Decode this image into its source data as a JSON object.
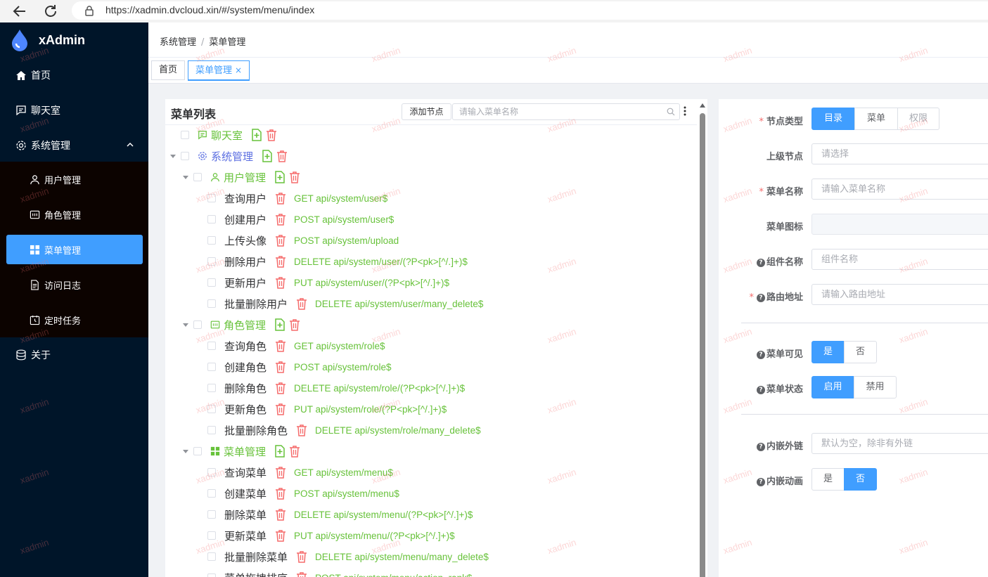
{
  "browser": {
    "url": "https://xadmin.dvcloud.xin/#/system/menu/index"
  },
  "app": {
    "name": "xAdmin"
  },
  "sidebar": {
    "items": [
      {
        "label": "首页",
        "icon": "home-icon"
      },
      {
        "label": "聊天室",
        "icon": "chat-icon"
      },
      {
        "label": "系统管理",
        "icon": "gear-icon"
      },
      {
        "label": "关于",
        "icon": "database-icon"
      }
    ],
    "submenu": [
      {
        "label": "用户管理",
        "icon": "user-icon"
      },
      {
        "label": "角色管理",
        "icon": "role-icon"
      },
      {
        "label": "菜单管理",
        "icon": "grid-icon",
        "active": true
      },
      {
        "label": "访问日志",
        "icon": "document-icon"
      },
      {
        "label": "定时任务",
        "icon": "clock-icon"
      }
    ]
  },
  "breadcrumb": {
    "first": "系统管理",
    "separator": "/",
    "second": "菜单管理"
  },
  "tabs": [
    {
      "label": "首页"
    },
    {
      "label": "菜单管理",
      "close": "×",
      "active": true
    }
  ],
  "tree_panel": {
    "title": "菜单列表",
    "add_node": "添加节点",
    "search_placeholder": "请输入菜单名称",
    "rows": [
      {
        "label": "聊天室",
        "level": 0,
        "kind": "menu",
        "icon": "chat-icon"
      },
      {
        "label": "系统管理",
        "level": 0,
        "kind": "dir",
        "icon": "gear-icon",
        "expanded": true
      },
      {
        "label": "用户管理",
        "level": 1,
        "kind": "menu",
        "icon": "user-icon",
        "expanded": true
      },
      {
        "label": "查询用户",
        "level": 2,
        "kind": "perm",
        "api": "GET api/system/user$"
      },
      {
        "label": "创建用户",
        "level": 2,
        "kind": "perm",
        "api": "POST api/system/user$"
      },
      {
        "label": "上传头像",
        "level": 2,
        "kind": "perm",
        "api": "POST api/system/upload"
      },
      {
        "label": "删除用户",
        "level": 2,
        "kind": "perm",
        "api": "DELETE api/system/user/(?P<pk>[^/.]+)$"
      },
      {
        "label": "更新用户",
        "level": 2,
        "kind": "perm",
        "api": "PUT api/system/user/(?P<pk>[^/.]+)$"
      },
      {
        "label": "批量删除用户",
        "level": 2,
        "kind": "perm",
        "api": "DELETE api/system/user/many_delete$"
      },
      {
        "label": "角色管理",
        "level": 1,
        "kind": "menu",
        "icon": "role-icon",
        "expanded": true
      },
      {
        "label": "查询角色",
        "level": 2,
        "kind": "perm",
        "api": "GET api/system/role$"
      },
      {
        "label": "创建角色",
        "level": 2,
        "kind": "perm",
        "api": "POST api/system/role$"
      },
      {
        "label": "删除角色",
        "level": 2,
        "kind": "perm",
        "api": "DELETE api/system/role/(?P<pk>[^/.]+)$"
      },
      {
        "label": "更新角色",
        "level": 2,
        "kind": "perm",
        "api": "PUT api/system/role/(?P<pk>[^/.]+)$"
      },
      {
        "label": "批量删除角色",
        "level": 2,
        "kind": "perm",
        "api": "DELETE api/system/role/many_delete$"
      },
      {
        "label": "菜单管理",
        "level": 1,
        "kind": "menu",
        "icon": "grid-icon",
        "expanded": true
      },
      {
        "label": "查询菜单",
        "level": 2,
        "kind": "perm",
        "api": "GET api/system/menu$"
      },
      {
        "label": "创建菜单",
        "level": 2,
        "kind": "perm",
        "api": "POST api/system/menu$"
      },
      {
        "label": "删除菜单",
        "level": 2,
        "kind": "perm",
        "api": "DELETE api/system/menu/(?P<pk>[^/.]+)$"
      },
      {
        "label": "更新菜单",
        "level": 2,
        "kind": "perm",
        "api": "PUT api/system/menu/(?P<pk>[^/.]+)$"
      },
      {
        "label": "批量删除菜单",
        "level": 2,
        "kind": "perm",
        "api": "DELETE api/system/menu/many_delete$"
      },
      {
        "label": "菜单拖拽排序",
        "level": 2,
        "kind": "perm",
        "api": "POST api/system/menu/action_rank$"
      }
    ]
  },
  "form": {
    "node_type": {
      "label": "节点类型",
      "required": true,
      "options": [
        "目录",
        "菜单",
        "权限"
      ],
      "selected": "目录"
    },
    "parent": {
      "label": "上级节点",
      "placeholder": "请选择"
    },
    "menu_name": {
      "label": "菜单名称",
      "required": true,
      "placeholder": "请输入菜单名称"
    },
    "menu_icon": {
      "label": "菜单图标"
    },
    "component_name": {
      "label": "组件名称",
      "placeholder": "组件名称"
    },
    "route_path": {
      "label": "路由地址",
      "required": true,
      "placeholder": "请输入路由地址"
    },
    "visible": {
      "label": "菜单可见",
      "options": [
        "是",
        "否"
      ],
      "selected": "是"
    },
    "status": {
      "label": "菜单状态",
      "options": [
        "启用",
        "禁用"
      ],
      "selected": "启用"
    },
    "frame_url": {
      "label": "内嵌外链",
      "placeholder": "默认为空，除非有外链"
    },
    "frame_animation": {
      "label": "内嵌动画",
      "options": [
        "是",
        "否"
      ],
      "selected": "否"
    }
  },
  "watermark": {
    "text": "xadmin"
  },
  "colors": {
    "sidebar": "#001529",
    "primary": "#409eff",
    "success": "#67c23a",
    "danger": "#f56c6c",
    "dir": "#5b6ee1"
  }
}
